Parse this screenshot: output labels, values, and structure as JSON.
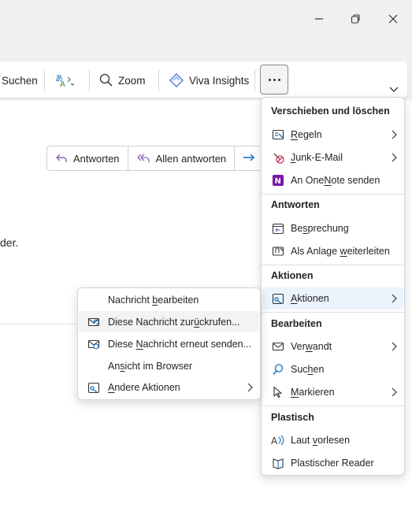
{
  "window": {
    "minimize": "─",
    "maximize": "❐",
    "close": "✕"
  },
  "ribbon": {
    "search_label": "Suchen",
    "zoom_label": "Zoom",
    "viva_label": "Viva Insights",
    "more_label": "Weitere Befehle"
  },
  "reply_bar": {
    "reply": "Antworten",
    "reply_all": "Allen antworten"
  },
  "body_text": "der.",
  "menu": {
    "section1": "Verschieben und löschen",
    "rules": {
      "pre": "",
      "key": "R",
      "post": "egeln"
    },
    "junk": {
      "pre": "",
      "key": "J",
      "post": "unk-E-Mail"
    },
    "onenote": {
      "pre": "An One",
      "key": "N",
      "post": "ote senden"
    },
    "section2": "Antworten",
    "meeting": {
      "pre": "Be",
      "key": "s",
      "post": "prechung"
    },
    "attach": {
      "pre": "Als Anlage ",
      "key": "w",
      "post": "eiterleiten"
    },
    "section3": "Aktionen",
    "actions": {
      "pre": "",
      "key": "A",
      "post": "ktionen"
    },
    "section4": "Bearbeiten",
    "related": {
      "pre": "Ver",
      "key": "w",
      "post": "andt"
    },
    "find": {
      "pre": "Suc",
      "key": "h",
      "post": "en"
    },
    "mark": {
      "pre": "",
      "key": "M",
      "post": "arkieren"
    },
    "section5": "Plastisch",
    "read_aloud": {
      "pre": "Laut ",
      "key": "v",
      "post": "orlesen"
    },
    "reader": "Plastischer Reader"
  },
  "submenu": {
    "edit": {
      "pre": "Nachricht ",
      "key": "b",
      "post": "earbeiten"
    },
    "recall": {
      "pre": "Diese Nachricht zur",
      "key": "ü",
      "post": "ckrufen..."
    },
    "resend": {
      "pre": "Diese ",
      "key": "N",
      "post": "achricht erneut senden..."
    },
    "browser": {
      "pre": "An",
      "key": "s",
      "post": "icht im Browser"
    },
    "other": {
      "pre": "",
      "key": "A",
      "post": "ndere Aktionen"
    }
  },
  "colors": {
    "accent": "#0f6cbd",
    "onenote": "#7719aa",
    "junk_red": "#c4314b",
    "reply_purple": "#8764b8"
  }
}
